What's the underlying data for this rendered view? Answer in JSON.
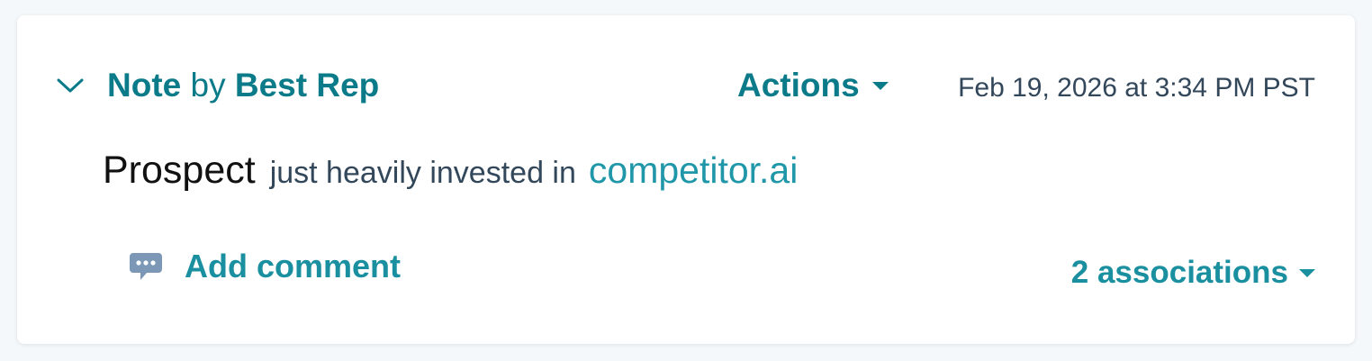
{
  "note": {
    "type_label": "Note",
    "by_label": "by",
    "author": "Best Rep",
    "actions_label": "Actions",
    "timestamp": "Feb 19, 2026 at 3:34 PM PST",
    "body": {
      "word_prospect": "Prospect",
      "text": "just heavily invested in",
      "link_text": "competitor.ai"
    },
    "add_comment_label": "Add comment",
    "associations_label": "2 associations"
  },
  "icons": {
    "collapse": "chevron-down-icon",
    "comment": "comment-icon",
    "actions_caret": "caret-down-icon",
    "associations_caret": "caret-down-icon"
  },
  "colors": {
    "accent": "#0b7b8a",
    "link": "#1f97a8",
    "text": "#33475b",
    "icon_gray": "#7c98b6",
    "background": "#f5f8fa",
    "card": "#ffffff"
  }
}
